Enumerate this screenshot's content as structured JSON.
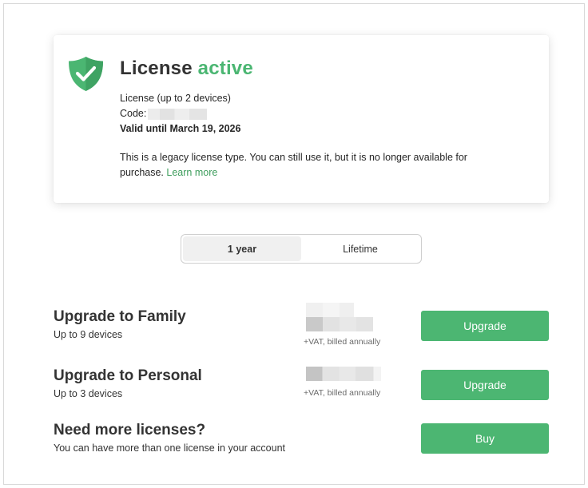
{
  "license": {
    "title_prefix": "License",
    "title_status": "active",
    "license_type": "License (up to 2 devices)",
    "code_label": "Code:",
    "valid_until": "Valid until March 19, 2026",
    "legacy_text": "This is a legacy license type. You can still use it, but it is no longer available for purchase.",
    "learn_more": "Learn more",
    "icon": "shield-check-icon",
    "accent_color": "#4bb672"
  },
  "period_toggle": {
    "options": [
      {
        "label": "1 year",
        "selected": true
      },
      {
        "label": "Lifetime",
        "selected": false
      }
    ]
  },
  "offers": [
    {
      "title": "Upgrade to Family",
      "subtitle": "Up to 9 devices",
      "price_note": "+VAT, billed annually",
      "button": "Upgrade"
    },
    {
      "title": "Upgrade to Personal",
      "subtitle": "Up to 3 devices",
      "price_note": "+VAT, billed annually",
      "button": "Upgrade"
    },
    {
      "title": "Need more licenses?",
      "subtitle": "You can have more than one license in your account",
      "button": "Buy"
    }
  ],
  "button_color": "#4cb672"
}
